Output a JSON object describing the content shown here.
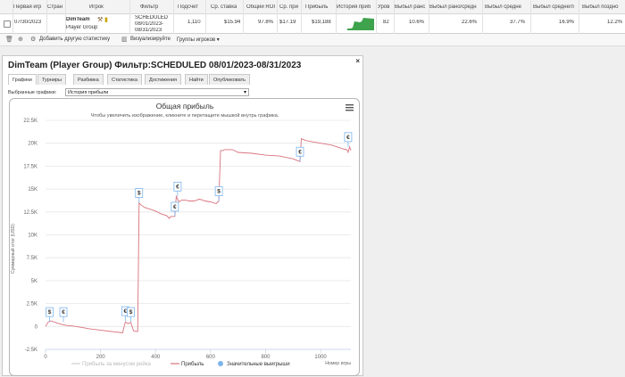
{
  "table": {
    "headers": [
      "Первая игр",
      "Стран",
      "Игрок",
      "Фильтр",
      "Подсчет",
      "Ср. ставка",
      "Общий ROI",
      "Ср. при",
      "Прибыль",
      "История приб",
      "Уров",
      "Выбыл ранс",
      "Выбыл рано/средн",
      "Выбыл средне",
      "Выбыл средне/п",
      "Выбыл поздно"
    ],
    "row": {
      "first_game": "07/30/2023",
      "player_name": "DimTeam",
      "player_group": "Player Group",
      "filter_line1": "SCHEDULED",
      "filter_line2": "08/01/2023-",
      "filter_line3": "08/31/2023",
      "count": "1,110",
      "avg_stake": "$15.94",
      "total_roi": "97.8%",
      "avg_profit": "$17.19",
      "profit": "$19,188",
      "level": "82",
      "early_out": "10.6%",
      "early_mid_out": "22.6%",
      "mid_out": "37.7%",
      "mid_late_out": "16.9%",
      "late_out": "12.2%"
    }
  },
  "toolbar": {
    "add_stats": "Добавить другую статистику",
    "visualize": "Визуализируйте",
    "player_groups": "Группы игроков",
    "player_groups_caret": "▾"
  },
  "dialog": {
    "title": "DimTeam (Player Group) Фильтр:SCHEDULED 08/01/2023-08/31/2023",
    "close": "×",
    "tabs": [
      "Графики",
      "Турниры",
      "Разбивка",
      "Статистика",
      "Достижения",
      "Найти",
      "Опубликовать"
    ],
    "active_tab": 0,
    "chart_select_label": "Выбранные графики:",
    "chart_select_value": "История прибыли"
  },
  "chart_data": {
    "type": "line",
    "title": "Общая прибыль",
    "subtitle": "Чтобы увеличить изображение, кликните и перетащите мышкой внутрь графика.",
    "xlabel": "Номер игры",
    "ylabel": "Суммарный итог (USD)",
    "xlim": [
      0,
      1110
    ],
    "ylim": [
      -2500,
      22500
    ],
    "x_ticks": [
      "0",
      "200",
      "400",
      "600",
      "800",
      "1000"
    ],
    "x_tick_values": [
      0,
      200,
      400,
      600,
      800,
      1000
    ],
    "y_ticks": [
      "-2.5K",
      "0",
      "2.5K",
      "5K",
      "7.5K",
      "10K",
      "12.5K",
      "15K",
      "17.5K",
      "20K",
      "22.5K"
    ],
    "y_tick_values": [
      -2500,
      0,
      2500,
      5000,
      7500,
      10000,
      12500,
      15000,
      17500,
      20000,
      22500
    ],
    "grid": true,
    "legend_position": "bottom",
    "legend": [
      "Прибыль за минусом рейка",
      "Прибыль",
      "Значительные выигрыши"
    ],
    "series": [
      {
        "name": "Прибыль",
        "color": "#d9737f",
        "x": [
          0,
          10,
          20,
          40,
          60,
          80,
          100,
          130,
          160,
          200,
          240,
          270,
          280,
          290,
          300,
          310,
          320,
          335,
          340,
          345,
          360,
          380,
          400,
          420,
          440,
          450,
          455,
          470,
          475,
          485,
          495,
          510,
          520,
          540,
          560,
          580,
          600,
          620,
          630,
          636,
          645,
          650,
          680,
          700,
          750,
          800,
          850,
          900,
          925,
          930,
          945,
          960,
          1000,
          1040,
          1060,
          1080,
          1095,
          1100,
          1105,
          1110
        ],
        "y": [
          0,
          500,
          600,
          400,
          200,
          100,
          50,
          -100,
          -250,
          -400,
          -550,
          -650,
          -700,
          500,
          300,
          450,
          -500,
          -550,
          13500,
          13300,
          13000,
          12800,
          12600,
          12300,
          12100,
          11800,
          12000,
          12000,
          14200,
          13600,
          13800,
          13800,
          13700,
          13700,
          13900,
          13700,
          13600,
          13400,
          13700,
          19200,
          19200,
          19300,
          19300,
          19000,
          18900,
          18700,
          18600,
          18300,
          18000,
          20500,
          20300,
          20200,
          20000,
          19800,
          19600,
          19400,
          19300,
          19000,
          19600,
          19200
        ]
      }
    ],
    "big_wins": [
      {
        "x": 15,
        "y": 500,
        "symbol": "$"
      },
      {
        "x": 65,
        "y": 500,
        "symbol": "€"
      },
      {
        "x": 290,
        "y": 600,
        "symbol": "€"
      },
      {
        "x": 310,
        "y": 500,
        "symbol": "$"
      },
      {
        "x": 340,
        "y": 13500,
        "symbol": "$"
      },
      {
        "x": 470,
        "y": 12000,
        "symbol": "€"
      },
      {
        "x": 480,
        "y": 14200,
        "symbol": "€"
      },
      {
        "x": 630,
        "y": 13700,
        "symbol": "$"
      },
      {
        "x": 925,
        "y": 18000,
        "symbol": "€"
      },
      {
        "x": 1100,
        "y": 19600,
        "symbol": "€"
      }
    ]
  },
  "colors": {
    "profit_line": "#d9737f",
    "rake_line": "#cfcfcf",
    "big_win_marker": "#7cb5ec",
    "mini_chart": "#3fa34d"
  },
  "icons": {
    "trash": "trash-icon",
    "pin": "pin-icon",
    "wrench": "wrench-icon",
    "chart": "chart-icon",
    "menu": "hamburger-menu-icon",
    "close": "close-icon"
  }
}
